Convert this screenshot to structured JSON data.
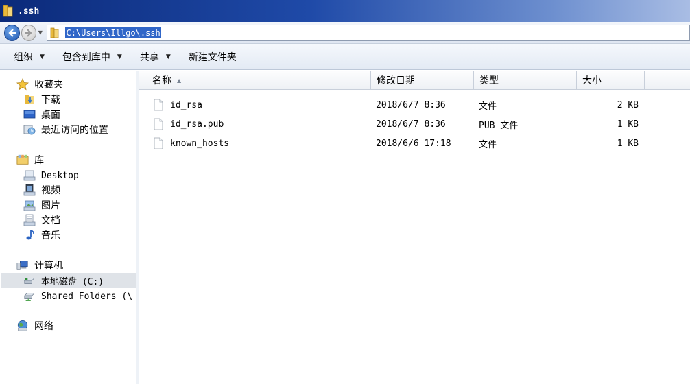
{
  "window": {
    "title": ".ssh"
  },
  "address": {
    "path": "C:\\Users\\Illgo\\.ssh"
  },
  "toolbar": {
    "organize": "组织",
    "include_in_library": "包含到库中",
    "share": "共享",
    "new_folder": "新建文件夹"
  },
  "nav": {
    "favorites": "收藏夹",
    "downloads": "下载",
    "desktop": "桌面",
    "recent_places": "最近访问的位置",
    "libraries": "库",
    "lib_desktop": "Desktop",
    "videos": "视频",
    "pictures": "图片",
    "documents": "文档",
    "music": "音乐",
    "computer": "计算机",
    "local_disk": "本地磁盘 (C:)",
    "shared_folders": "Shared Folders (\\",
    "network": "网络"
  },
  "columns": {
    "name": "名称",
    "modified": "修改日期",
    "type": "类型",
    "size": "大小"
  },
  "files": [
    {
      "name": "id_rsa",
      "modified": "2018/6/7 8:36",
      "type": "文件",
      "size": "2 KB"
    },
    {
      "name": "id_rsa.pub",
      "modified": "2018/6/7 8:36",
      "type": "PUB 文件",
      "size": "1 KB"
    },
    {
      "name": "known_hosts",
      "modified": "2018/6/6 17:18",
      "type": "文件",
      "size": "1 KB"
    }
  ],
  "colors": {
    "selection": "#3066c8",
    "title_start": "#0b2a7a"
  }
}
